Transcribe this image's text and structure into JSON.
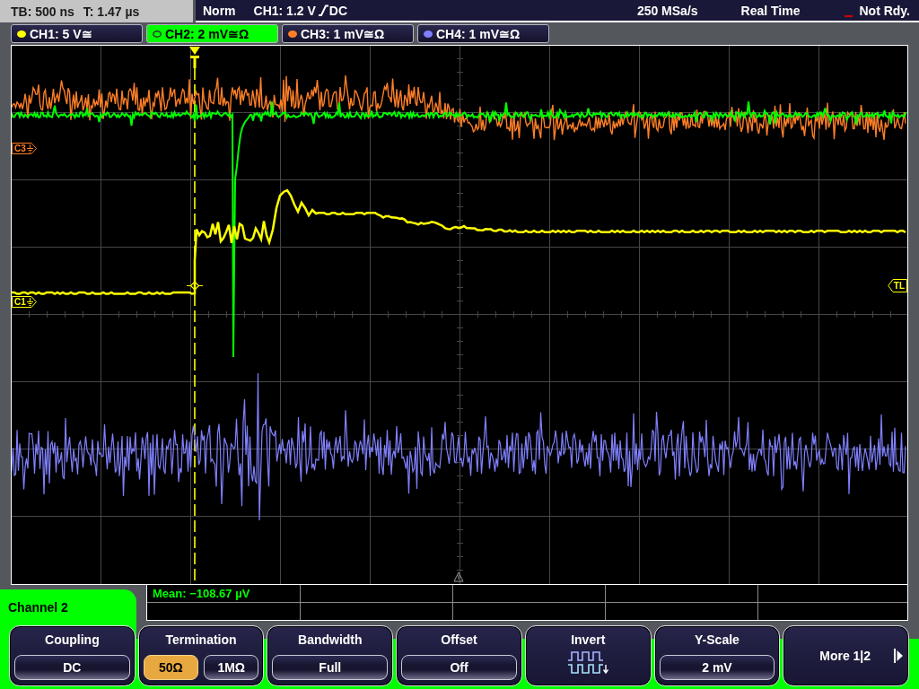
{
  "status_bar": {
    "timebase": "TB: 500 ns",
    "trigger_offset": "T: 1.47 µs",
    "trigger_mode": "Norm",
    "trigger_source": "CH1: 1.2 V",
    "trigger_coupling": "DC",
    "sample_rate": "250 MSa/s",
    "acquisition_mode": "Real Time",
    "acquisition_state": "Not Rdy."
  },
  "channels": [
    {
      "label": "CH1: 5 V≅",
      "color": "#ffff00",
      "selected": false
    },
    {
      "label": "CH2: 2 mV≅Ω",
      "color": "#00ff00",
      "selected": true
    },
    {
      "label": "CH3: 1 mV≅Ω",
      "color": "#ff7f27",
      "selected": false
    },
    {
      "label": "CH4: 1 mV≅Ω",
      "color": "#8080ff",
      "selected": false
    }
  ],
  "display": {
    "markers": [
      {
        "label": "C3",
        "color": "#ff7f27"
      },
      {
        "label": "C1",
        "color": "#ffff00"
      }
    ],
    "trigger_level_marker": "TL"
  },
  "measurements": [
    "Mean: −108.67 µV"
  ],
  "menu": {
    "title": "Channel 2",
    "softkeys": [
      {
        "kind": "value",
        "label": "Coupling",
        "value": "DC"
      },
      {
        "kind": "options",
        "label": "Termination",
        "options": [
          {
            "label": "50Ω",
            "selected": true
          },
          {
            "label": "1MΩ",
            "selected": false
          }
        ]
      },
      {
        "kind": "value",
        "label": "Bandwidth",
        "value": "Full"
      },
      {
        "kind": "value",
        "label": "Offset",
        "value": "Off"
      },
      {
        "kind": "invert",
        "label": "Invert"
      },
      {
        "kind": "value",
        "label": "Y-Scale",
        "value": "2 mV"
      },
      {
        "kind": "more",
        "label": "More 1|2"
      }
    ]
  }
}
